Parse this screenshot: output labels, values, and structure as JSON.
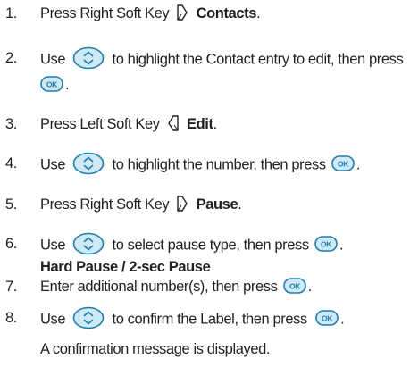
{
  "steps": [
    {
      "number": "1.",
      "a": "Press Right Soft Key",
      "b": "Contacts",
      "c": ".",
      "icon": "right-soft-key-icon"
    },
    {
      "number": "2.",
      "a": "Use",
      "b": "to highlight the Contact entry to edit, then press",
      "c": ".",
      "icons": [
        "navigation-key-icon",
        "ok-key-icon"
      ]
    },
    {
      "number": "3.",
      "a": "Press Left Soft Key",
      "b": "Edit",
      "c": ".",
      "icon": "left-soft-key-icon"
    },
    {
      "number": "4.",
      "a": "Use",
      "b": "to highlight the number, then press",
      "c": ".",
      "icons": [
        "navigation-key-icon",
        "ok-key-icon"
      ]
    },
    {
      "number": "5.",
      "a": "Press Right Soft Key",
      "b": "Pause",
      "c": ".",
      "icon": "right-soft-key-icon"
    },
    {
      "number": "6.",
      "a": "Use",
      "b": "to select pause type, then press",
      "c": ".",
      "d": "Hard Pause / 2-sec Pause",
      "icons": [
        "navigation-key-icon",
        "ok-key-icon"
      ]
    },
    {
      "number": "7.",
      "a": "Enter additional number(s), then press",
      "c": ".",
      "icon": "ok-key-icon"
    },
    {
      "number": "8.",
      "a": "Use",
      "b": "to confirm the Label, then press",
      "c": ".",
      "icons": [
        "navigation-key-icon",
        "ok-key-icon"
      ]
    }
  ],
  "note": "A confirmation message is displayed.",
  "ok_label": "OK",
  "colors": {
    "text": "#231f20",
    "key_fill": "#cfe9f5",
    "key_stroke": "#1f7db0"
  }
}
